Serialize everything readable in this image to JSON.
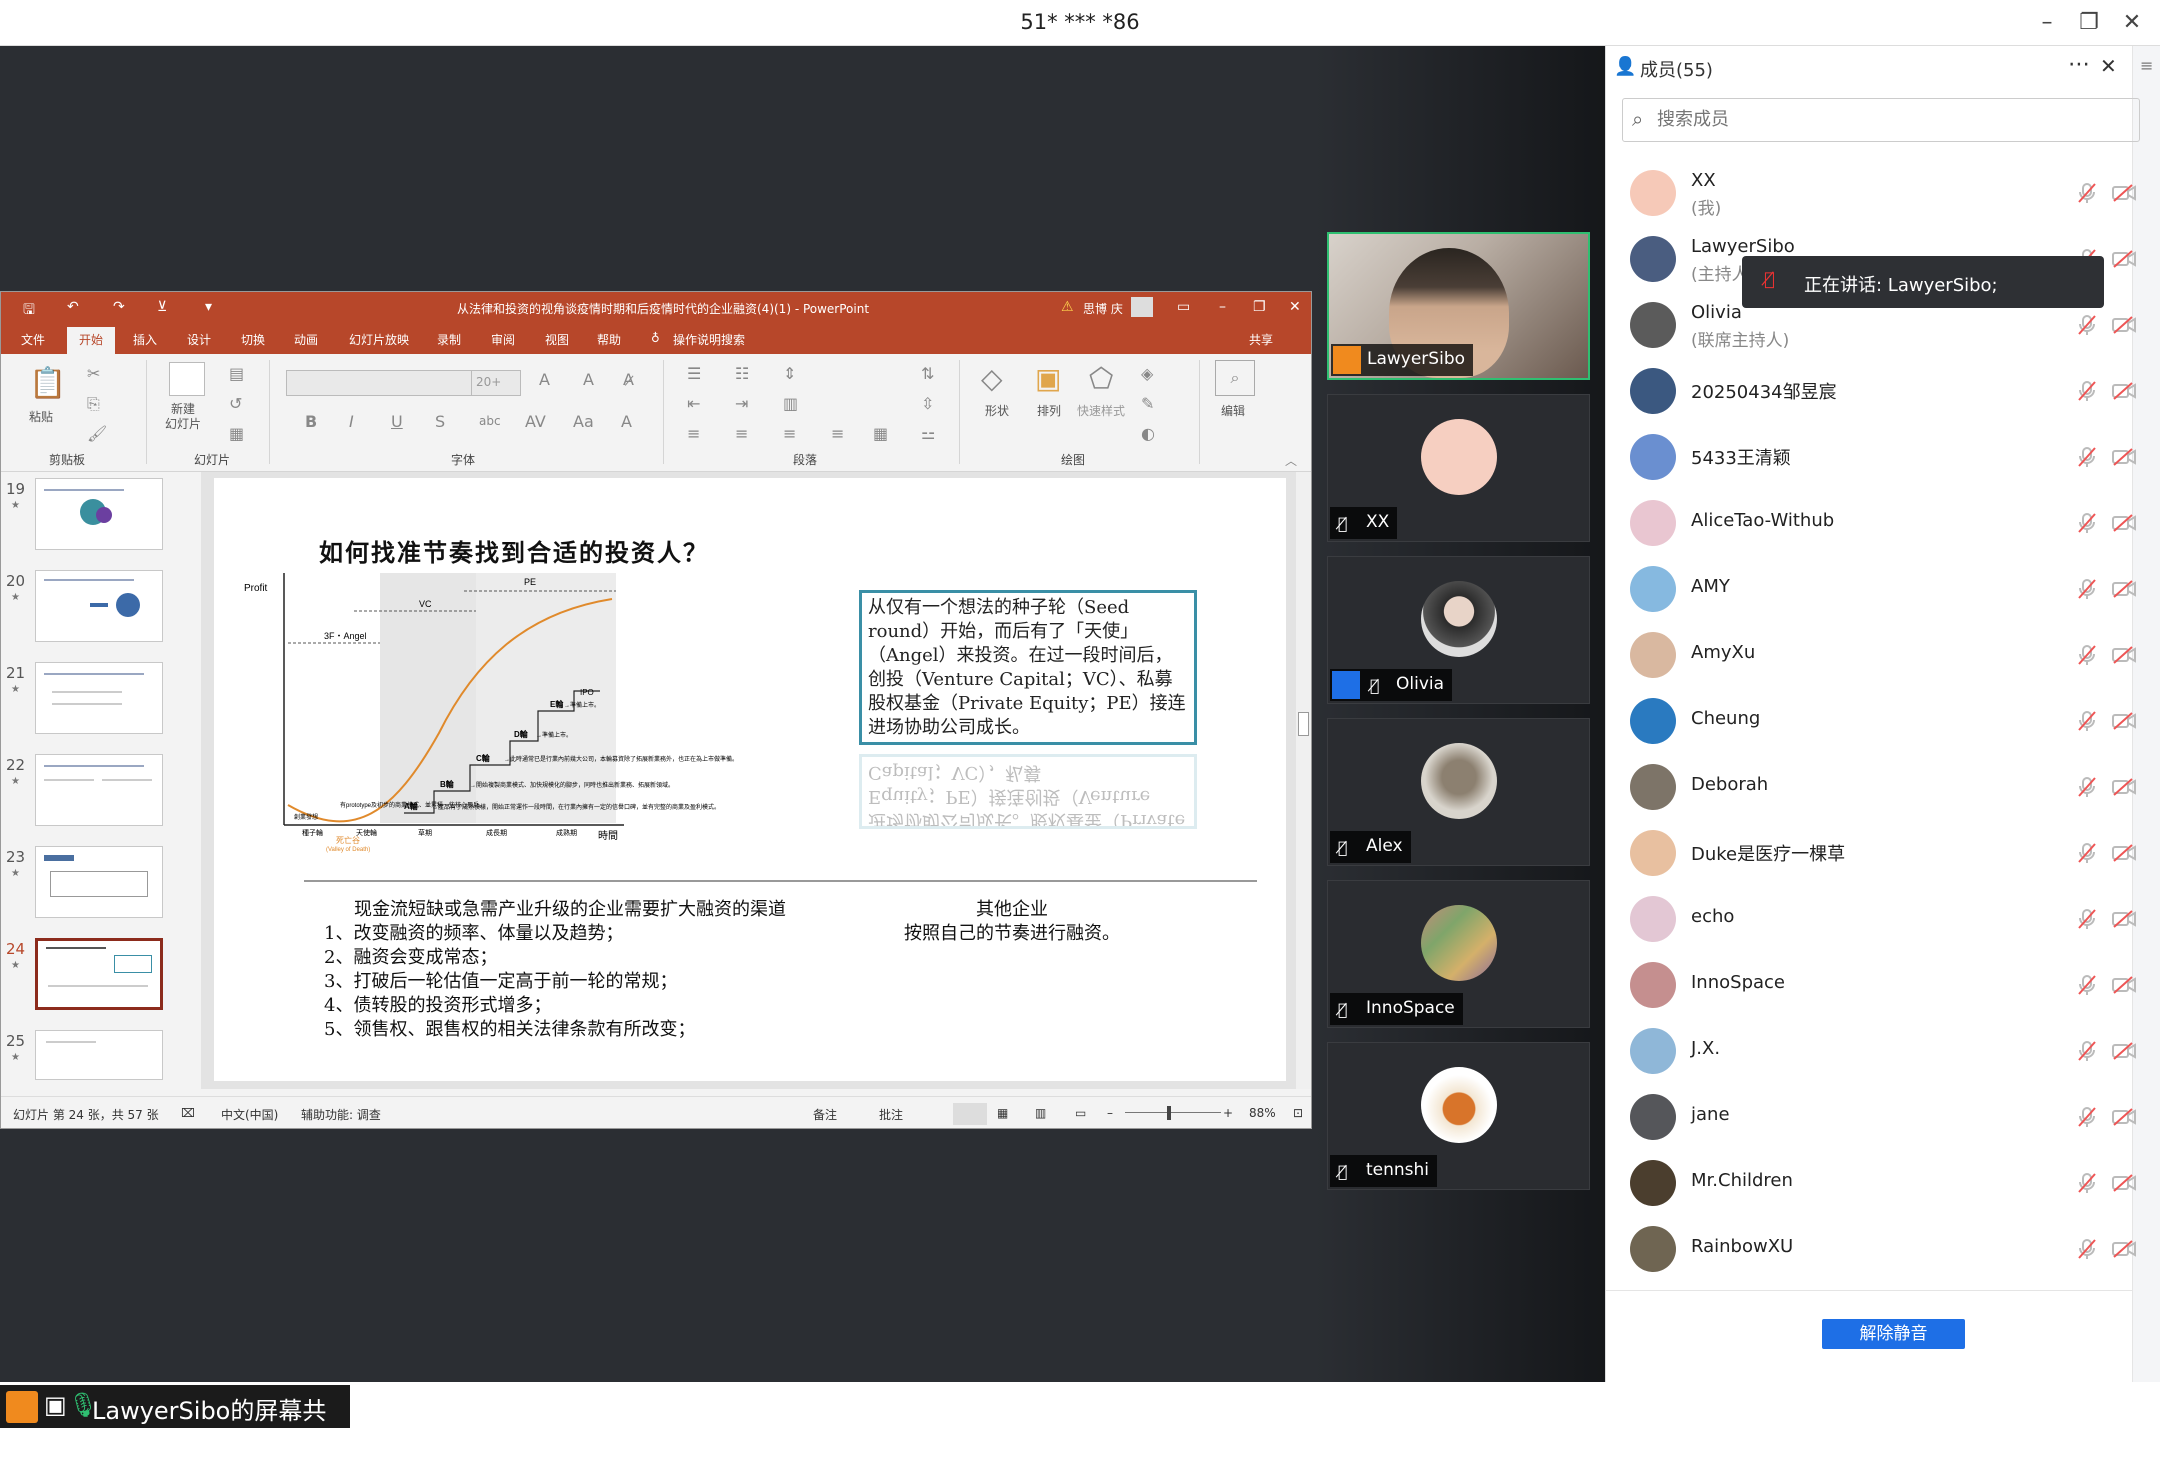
{
  "window": {
    "title": "51* *** *86"
  },
  "ppt": {
    "doc_title": "从法律和投资的视角谈疫情时期和后疫情时代的企业融资(4)(1) - PowerPoint",
    "user": "思博 庆",
    "tabs": [
      "文件",
      "开始",
      "插入",
      "设计",
      "切换",
      "动画",
      "幻灯片放映",
      "录制",
      "审阅",
      "视图",
      "帮助",
      "操作说明搜索"
    ],
    "share": "共享",
    "groups": {
      "clipboard": "剪贴板",
      "slides": "幻灯片",
      "font": "字体",
      "paragraph": "段落",
      "drawing": "绘图"
    },
    "buttons": {
      "paste": "粘贴",
      "new_slide": "新建\n幻灯片",
      "shape": "形状",
      "arrange": "排列",
      "quick_style": "快速样式",
      "edit": "编辑"
    },
    "font_size": "20+",
    "thumbs": [
      "19",
      "20",
      "21",
      "22",
      "23",
      "24",
      "25"
    ],
    "active_thumb": "24",
    "status": {
      "slide": "幻灯片 第 24 张，共 57 张",
      "lang": "中文(中国)",
      "access": "辅助功能: 调查",
      "notes": "备注",
      "comments": "批注",
      "zoom": "88%"
    }
  },
  "slide": {
    "title": "如何找准节奏找到合适的投资人？",
    "chart": {
      "ylabel": "Profit",
      "xlabel": "時間",
      "stages_x": [
        "種子輪",
        "天使輪",
        "草期",
        "成長期",
        "成熟期"
      ],
      "bands": [
        "3F・Angel",
        "VC",
        "PE"
      ],
      "steps": [
        "A輪",
        "B輪",
        "C輪",
        "D輪",
        "E輪",
        "IPO"
      ],
      "valley": "死亡谷",
      "valley_en": "(Valley of Death)",
      "notes": {
        "a": "→產品有了成熟模樣，開始正常運作一段時間，在行業內擁有一定的信譽口碑，並有完整的商業及盈利模式。",
        "b": "→開始複製商業模式、加快規模化的腳步，同時也推出新業務、拓展新領域。",
        "c": "→此時通常已是行業內前幾大公司，本輪募資除了拓展新業務外，也正在為上市做準備。",
        "d": "→準備上市。",
        "e": "→準備上市。",
        "seed": "創業發想",
        "angel": "有prototype及初步的商業模式、並累積一些核心用戶。"
      }
    },
    "quote": "从仅有一个想法的种子轮（Seed round）开始，而后有了「天使」（Angel）来投资。在过一段时间后，创投（Venture Capital；VC）、私募股权基金（Private Equity；PE）接连进场协助公司成长。",
    "quote_reflection": "进场协助公司成长。股权基金（Private Equity；PE）接连创投（Venture Capital；VC），私募",
    "left_heading": "现金流短缺或急需产业升级的企业需要扩大融资的渠道",
    "left_items": [
      "1、改变融资的频率、体量以及趋势；",
      "2、融资会变成常态；",
      "3、打破后一轮估值一定高于前一轮的常规；",
      "4、债转股的投资形式增多；",
      "5、领售权、跟售权的相关法律条款有所改变；"
    ],
    "right_heading": "其他企业",
    "right_text": "按照自己的节奏进行融资。"
  },
  "share_label": "LawyerSibo的屏幕共享",
  "videos": [
    {
      "name": "LawyerSibo",
      "type": "camera",
      "active": true,
      "mic": "on"
    },
    {
      "name": "XX",
      "type": "avatar",
      "avatar": "pig-icon",
      "mic": "off"
    },
    {
      "name": "Olivia",
      "type": "avatar",
      "avatar": "woman-portrait",
      "mic": "off"
    },
    {
      "name": "Alex",
      "type": "avatar",
      "avatar": "buddha-statue",
      "mic": "off"
    },
    {
      "name": "InnoSpace",
      "type": "avatar",
      "avatar": "group-photo",
      "mic": "off"
    },
    {
      "name": "tennshi",
      "type": "avatar",
      "avatar": "iced-tea",
      "mic": "off"
    }
  ],
  "panel": {
    "title": "成员(55)",
    "search_placeholder": "搜索成员",
    "members": [
      {
        "name": "XX",
        "sub": "(我)",
        "color": "#f6c9b8"
      },
      {
        "name": "LawyerSibo",
        "sub": "(主持人)",
        "color": "#4a5d80"
      },
      {
        "name": "Olivia",
        "sub": "(联席主持人)",
        "color": "#5b5b5b"
      },
      {
        "name": "20250434邹昱宸",
        "sub": "",
        "color": "#3b5880"
      },
      {
        "name": "5433王清颖",
        "sub": "",
        "color": "#6a8fd0"
      },
      {
        "name": "AliceTao-Withub",
        "sub": "",
        "color": "#e9c6d1"
      },
      {
        "name": "AMY",
        "sub": "",
        "color": "#86b9e0"
      },
      {
        "name": "AmyXu",
        "sub": "",
        "color": "#d9b8a0"
      },
      {
        "name": "Cheung",
        "sub": "",
        "color": "#2a7ac0"
      },
      {
        "name": "Deborah",
        "sub": "",
        "color": "#7d7468"
      },
      {
        "name": "Duke是医疗一棵草",
        "sub": "",
        "color": "#e8c0a0"
      },
      {
        "name": "echo",
        "sub": "",
        "color": "#e3c7d4"
      },
      {
        "name": "InnoSpace",
        "sub": "",
        "color": "#c58f8f"
      },
      {
        "name": "J.X.",
        "sub": "",
        "color": "#8fb7d8"
      },
      {
        "name": "jane",
        "sub": "",
        "color": "#55565a"
      },
      {
        "name": "Mr.Children",
        "sub": "",
        "color": "#4b3e2e"
      },
      {
        "name": "RainbowXU",
        "sub": "",
        "color": "#6f6552"
      }
    ],
    "tooltip": "正在讲话: LawyerSibo;",
    "unmute": "解除静音"
  }
}
